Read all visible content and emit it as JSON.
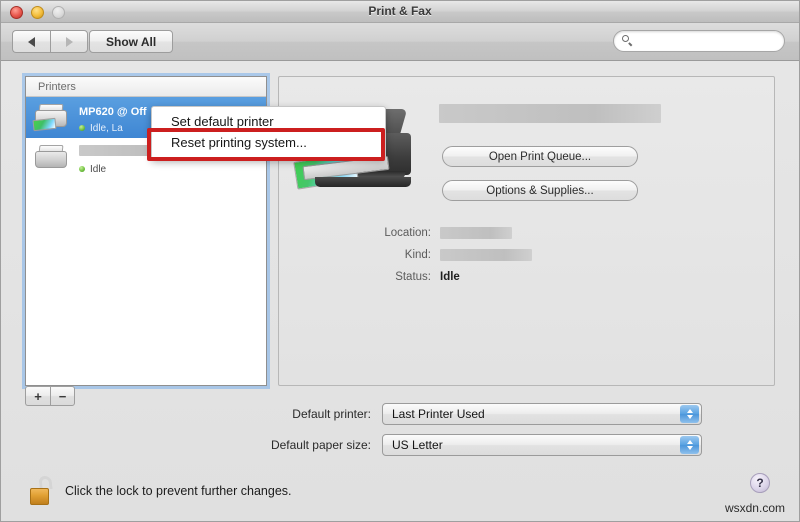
{
  "window": {
    "title": "Print & Fax",
    "traffic_lights": [
      "close-button",
      "minimize-button",
      "zoom-button"
    ]
  },
  "toolbar": {
    "back_label": "◀",
    "forward_label": "▶",
    "show_all_label": "Show All",
    "search": {
      "value": "",
      "placeholder": "",
      "icon": "search-icon"
    }
  },
  "printer_list": {
    "header": "Printers",
    "items": [
      {
        "name": "MP620 @ Off",
        "name_redacted": false,
        "status": "Idle, La",
        "selected": true,
        "icon": "printer-icon-color"
      },
      {
        "name": "",
        "name_redacted": true,
        "status": "Idle",
        "selected": false,
        "icon": "printer-icon-plain"
      }
    ],
    "add_label": "+",
    "remove_label": "−"
  },
  "context_menu": {
    "items": [
      {
        "label": "Set default printer",
        "highlighted": false
      },
      {
        "label": "Reset printing system...",
        "highlighted": true
      }
    ],
    "highlight_color": "#cc1f1f"
  },
  "detail": {
    "printer_name_redacted": true,
    "printer_illustration": "printer-illustration",
    "buttons": {
      "open_queue": "Open Print Queue...",
      "options_supplies": "Options & Supplies..."
    },
    "fields": [
      {
        "label": "Location:",
        "value": "",
        "redacted": true
      },
      {
        "label": "Kind:",
        "value": "",
        "redacted": true
      },
      {
        "label": "Status:",
        "value": "Idle",
        "redacted": false
      }
    ]
  },
  "bottom": {
    "default_printer": {
      "label": "Default printer:",
      "value": "Last Printer Used"
    },
    "default_paper_size": {
      "label": "Default paper size:",
      "value": "US Letter"
    }
  },
  "footer": {
    "lock_text": "Click the lock to prevent further changes.",
    "lock_icon": "padlock-open-icon",
    "help_label": "?",
    "watermark": "wsxdn.com"
  }
}
